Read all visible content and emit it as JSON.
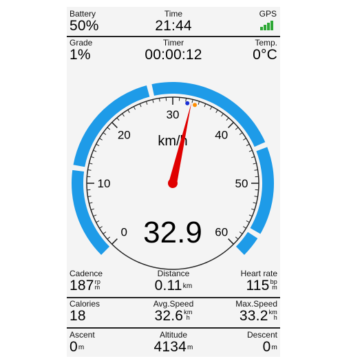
{
  "status": {
    "battery": {
      "label": "Battery",
      "value": "50%"
    },
    "time": {
      "label": "Time",
      "value": "21:44"
    },
    "gps": {
      "label": "GPS",
      "signal": "gps-signal-bars-icon",
      "color": "#2ea836"
    }
  },
  "top_fields": {
    "grade": {
      "label": "Grade",
      "value": "1%"
    },
    "timer": {
      "label": "Timer",
      "value": "00:00:12"
    },
    "temp": {
      "label": "Temp.",
      "value": "0°C"
    }
  },
  "gauge": {
    "unit": "km/h",
    "value": "32.9",
    "ticks": [
      "0",
      "10",
      "20",
      "30",
      "40",
      "50",
      "60"
    ],
    "min": 0,
    "max": 60,
    "needle_value": 32.9,
    "arc_color": "#1e9be8",
    "needle_color": "#e00000"
  },
  "fields": {
    "cadence": {
      "label": "Cadence",
      "value": "187",
      "unit_top": "rp",
      "unit_bottom": "m"
    },
    "distance": {
      "label": "Distance",
      "value": "0.11",
      "unit": "km"
    },
    "heart_rate": {
      "label": "Heart rate",
      "value": "115",
      "unit_top": "bp",
      "unit_bottom": "m"
    },
    "calories": {
      "label": "Calories",
      "value": "18"
    },
    "avg_speed": {
      "label": "Avg.Speed",
      "value": "32.6",
      "unit_top": "km",
      "unit_bottom": "h"
    },
    "max_speed": {
      "label": "Max.Speed",
      "value": "33.2",
      "unit_top": "km",
      "unit_bottom": "h"
    },
    "ascent": {
      "label": "Ascent",
      "value": "0",
      "unit": "m"
    },
    "altitude": {
      "label": "Altitude",
      "value": "4134",
      "unit": "m"
    },
    "descent": {
      "label": "Descent",
      "value": "0",
      "unit": "m"
    }
  }
}
